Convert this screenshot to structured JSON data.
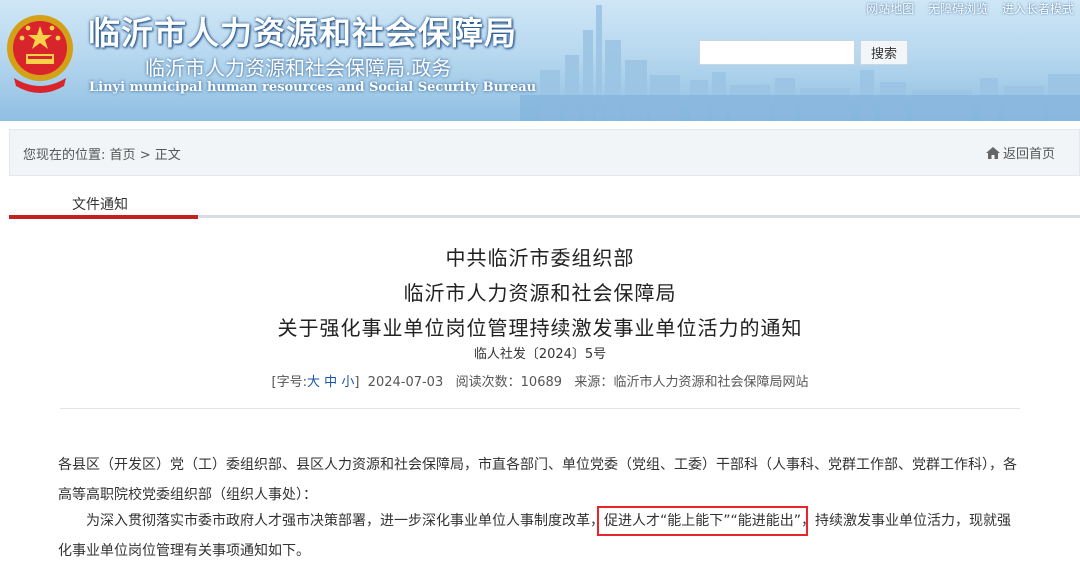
{
  "header": {
    "title_cn": "临沂市人力资源和社会保障局",
    "subtitle": "临沂市人力资源和社会保障局.政务",
    "title_en": "Linyi municipal human resources and Social Security Bureau",
    "top_links": [
      "网站地图",
      "无障碍浏览",
      "进入长者模式"
    ],
    "search_placeholder": "",
    "search_button": "搜索"
  },
  "breadcrumb": {
    "prefix": "您现在的位置:",
    "home": "首页",
    "separator": ">",
    "current": "正文",
    "back_home": "返回首页"
  },
  "tab": {
    "label": "文件通知"
  },
  "article": {
    "heading_lines": [
      "中共临沂市委组织部",
      "临沂市人力资源和社会保障局",
      "关于强化事业单位岗位管理持续激发事业单位活力的通知"
    ],
    "doc_number": "临人社发〔2024〕5号",
    "meta": {
      "font_label": "[字号:",
      "font_large": "大",
      "font_medium": "中",
      "font_small": "小",
      "font_end": "]",
      "date": "2024-07-03",
      "views_label": "阅读次数：",
      "views": "10689",
      "source_label": "来源：",
      "source": "临沂市人力资源和社会保障局网站"
    },
    "para1": "各县区（开发区）党（工）委组织部、县区人力资源和社会保障局，市直各部门、单位党委（党组、工委）干部科（人事科、党群工作部、党群工作科），各高等高职院校党委组织部（组织人事处）：",
    "para2_before": "为深入贯彻落实市委市政府人才强市决策部署，进一步深化事业单位人事制度改革，",
    "para2_highlight": "促进人才“能上能下”“能进能出”",
    "para2_after": "，持续激发事业单位活力，现就强化事业单位岗位管理有关事项通知如下。"
  },
  "colors": {
    "accent_red": "#c3211f",
    "highlight_box": "#e8262a",
    "link_blue": "#1a56a8",
    "header_sky": "#b7d8ef"
  }
}
